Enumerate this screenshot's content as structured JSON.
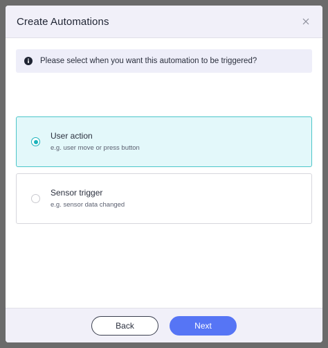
{
  "dialog": {
    "title": "Create Automations"
  },
  "info": {
    "text": "Please select when you want this automation to be triggered?"
  },
  "options": [
    {
      "title": "User action",
      "description": "e.g. user move or press button",
      "selected": true
    },
    {
      "title": "Sensor trigger",
      "description": "e.g. sensor data changed",
      "selected": false
    }
  ],
  "footer": {
    "back_label": "Back",
    "next_label": "Next"
  },
  "colors": {
    "accent": "#1bb3bb",
    "primary_button": "#5675f5",
    "selected_bg": "#e3f8fa",
    "header_bg": "#f1f0f9"
  },
  "icons": {
    "close": "close-icon",
    "info": "info-icon"
  }
}
